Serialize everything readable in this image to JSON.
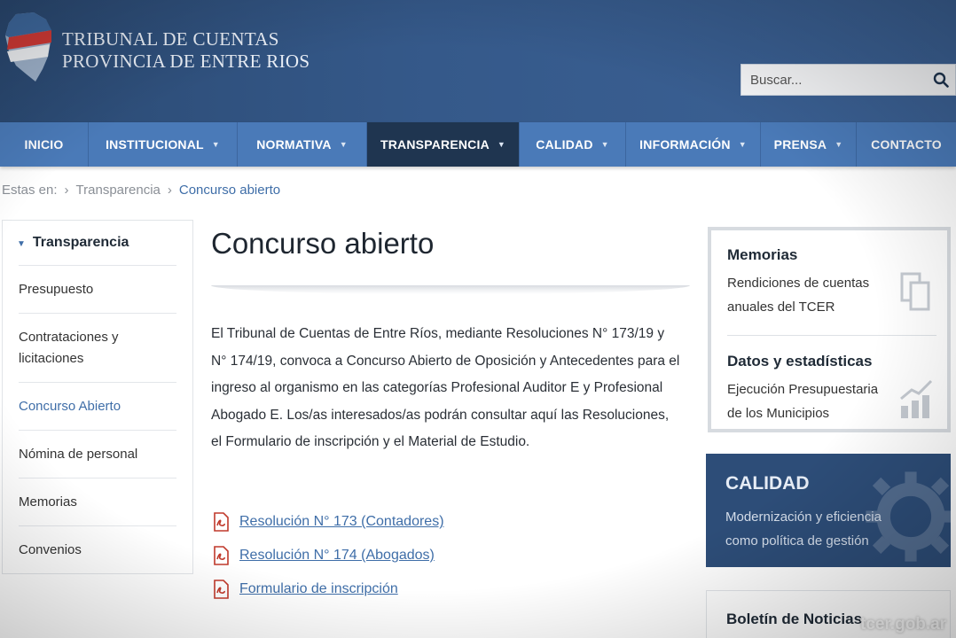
{
  "header": {
    "brand_line1": "TRIBUNAL DE CUENTAS",
    "brand_line2": "PROVINCIA DE ENTRE RIOS",
    "search_placeholder": "Buscar..."
  },
  "nav": {
    "items": [
      {
        "label": "INICIO",
        "caret": false,
        "active": false
      },
      {
        "label": "INSTITUCIONAL",
        "caret": true,
        "active": false
      },
      {
        "label": "NORMATIVA",
        "caret": true,
        "active": false
      },
      {
        "label": "TRANSPARENCIA",
        "caret": true,
        "active": true
      },
      {
        "label": "CALIDAD",
        "caret": true,
        "active": false
      },
      {
        "label": "INFORMACIÓN",
        "caret": true,
        "active": false
      },
      {
        "label": "PRENSA",
        "caret": true,
        "active": false
      },
      {
        "label": "CONTACTO",
        "caret": false,
        "active": false
      }
    ]
  },
  "breadcrumb": {
    "prefix": "Estas en:",
    "items": [
      "Transparencia",
      "Concurso abierto"
    ]
  },
  "sidebar": {
    "heading": "Transparencia",
    "items": [
      {
        "label": "Presupuesto",
        "active": false
      },
      {
        "label": "Contrataciones y licitaciones",
        "active": false
      },
      {
        "label": "Concurso Abierto",
        "active": true
      },
      {
        "label": "Nómina de personal",
        "active": false
      },
      {
        "label": "Memorias",
        "active": false
      },
      {
        "label": "Convenios",
        "active": false
      }
    ]
  },
  "main": {
    "title": "Concurso abierto",
    "intro": "El Tribunal de Cuentas de Entre Ríos, mediante Resoluciones N° 173/19 y N° 174/19, convoca a Concurso Abierto de Oposición y Antecedentes para el ingreso al organismo en las categorías Profesional Auditor E y Profesional Abogado E. Los/as interesados/as podrán consultar aquí las Resoluciones, el Formulario de inscripción y el Material de Estudio.",
    "links": [
      "Resolución N° 173 (Contadores)",
      "Resolución N° 174 (Abogados)",
      "Formulario de inscripción"
    ]
  },
  "right": {
    "memorias_title": "Memorias",
    "memorias_text": "Rendiciones de cuentas anuales del TCER",
    "datos_title": "Datos y estadísticas",
    "datos_text": "Ejecución Presupuestaria de los Municipios",
    "calidad_title": "CALIDAD",
    "calidad_text": "Modernización y eficiencia como política de gestión",
    "boletin_title": "Boletín de Noticias"
  },
  "watermark": "tcer.gob.ar",
  "colors": {
    "header_bg": "#35598a",
    "nav_bg": "#4a7ab8",
    "nav_active": "#1f3550",
    "link": "#3f6ea8",
    "calidad_bg": "#2d4d78"
  }
}
